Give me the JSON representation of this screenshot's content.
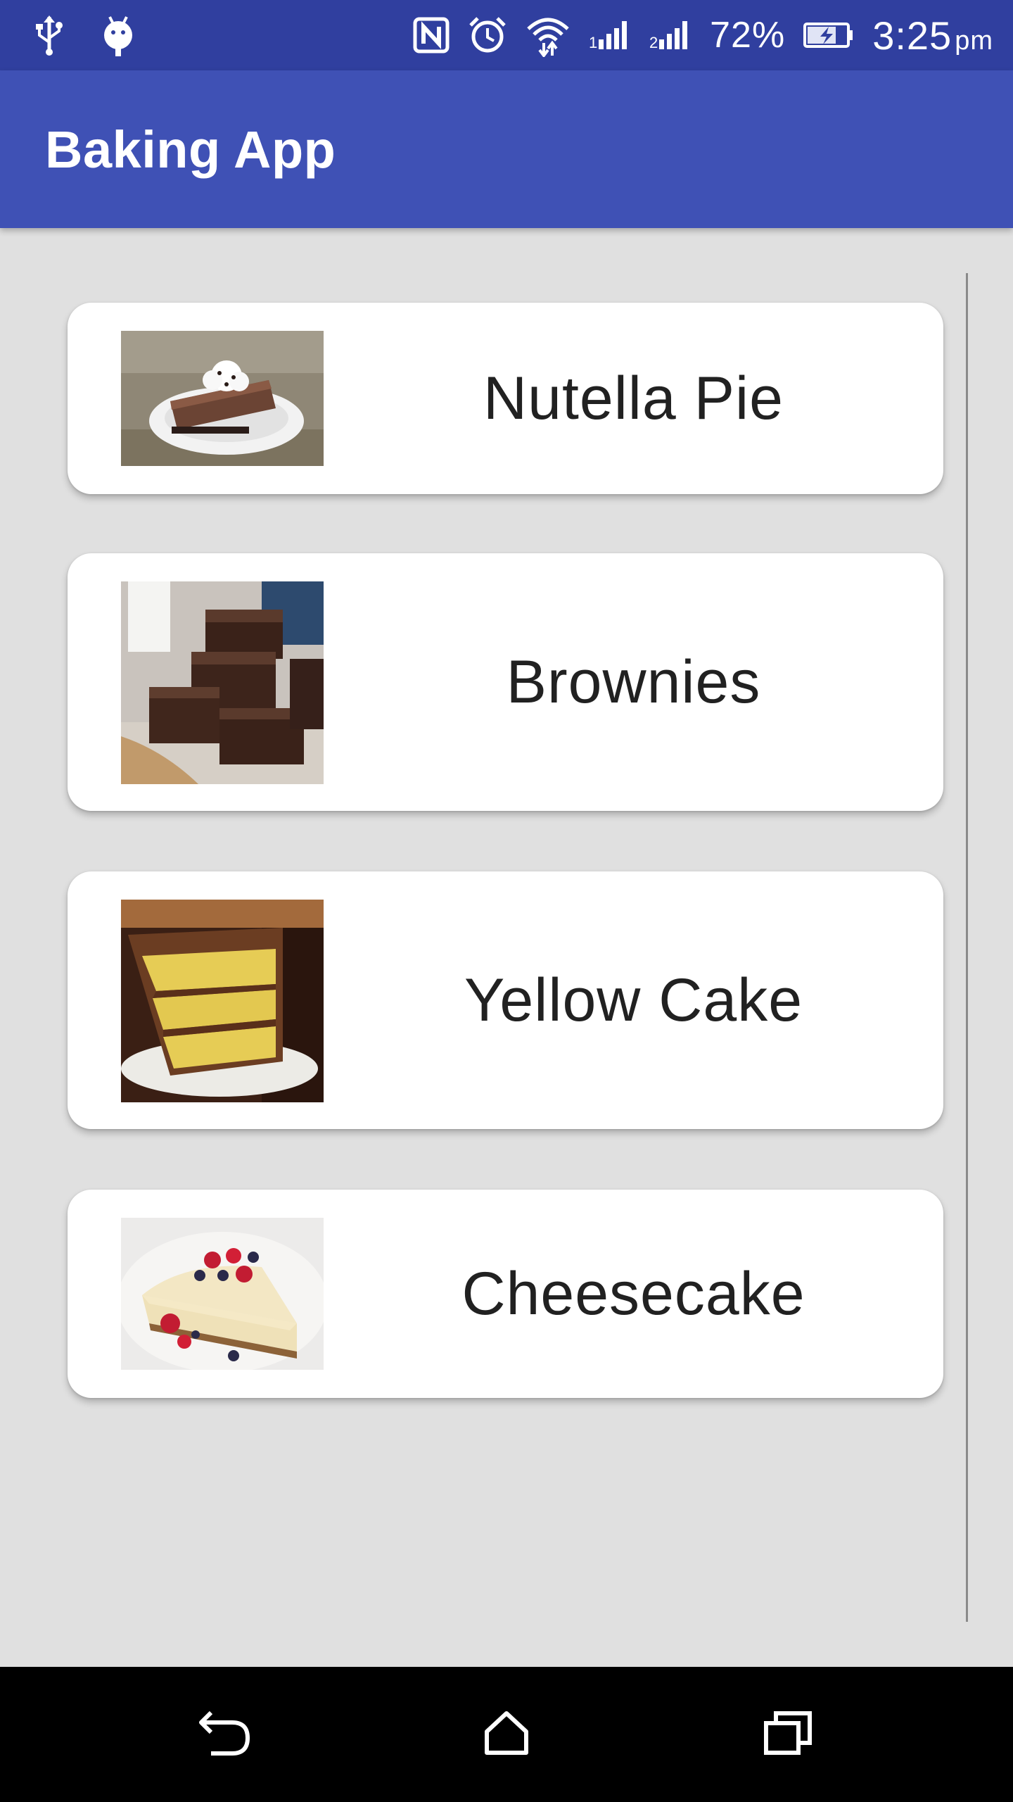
{
  "status_bar": {
    "battery_percent": "72%",
    "time": "3:25",
    "ampm": "pm",
    "icons": [
      "usb-icon",
      "android-debug-icon",
      "nfc-icon",
      "alarm-icon",
      "wifi-icon",
      "signal-1-icon",
      "signal-2-icon",
      "battery-charging-icon"
    ]
  },
  "app_bar": {
    "title": "Baking App"
  },
  "recipes": [
    {
      "name": "Nutella Pie",
      "image": "nutella-pie-photo"
    },
    {
      "name": "Brownies",
      "image": "brownies-photo"
    },
    {
      "name": "Yellow Cake",
      "image": "yellow-cake-photo"
    },
    {
      "name": "Cheesecake",
      "image": "cheesecake-photo"
    }
  ],
  "nav_bar": {
    "buttons": [
      "back-icon",
      "home-icon",
      "recents-icon"
    ]
  },
  "colors": {
    "status_bar": "#303f9f",
    "app_bar": "#3f51b5",
    "background": "#e0e0e0",
    "card": "#ffffff",
    "text": "#212121"
  }
}
